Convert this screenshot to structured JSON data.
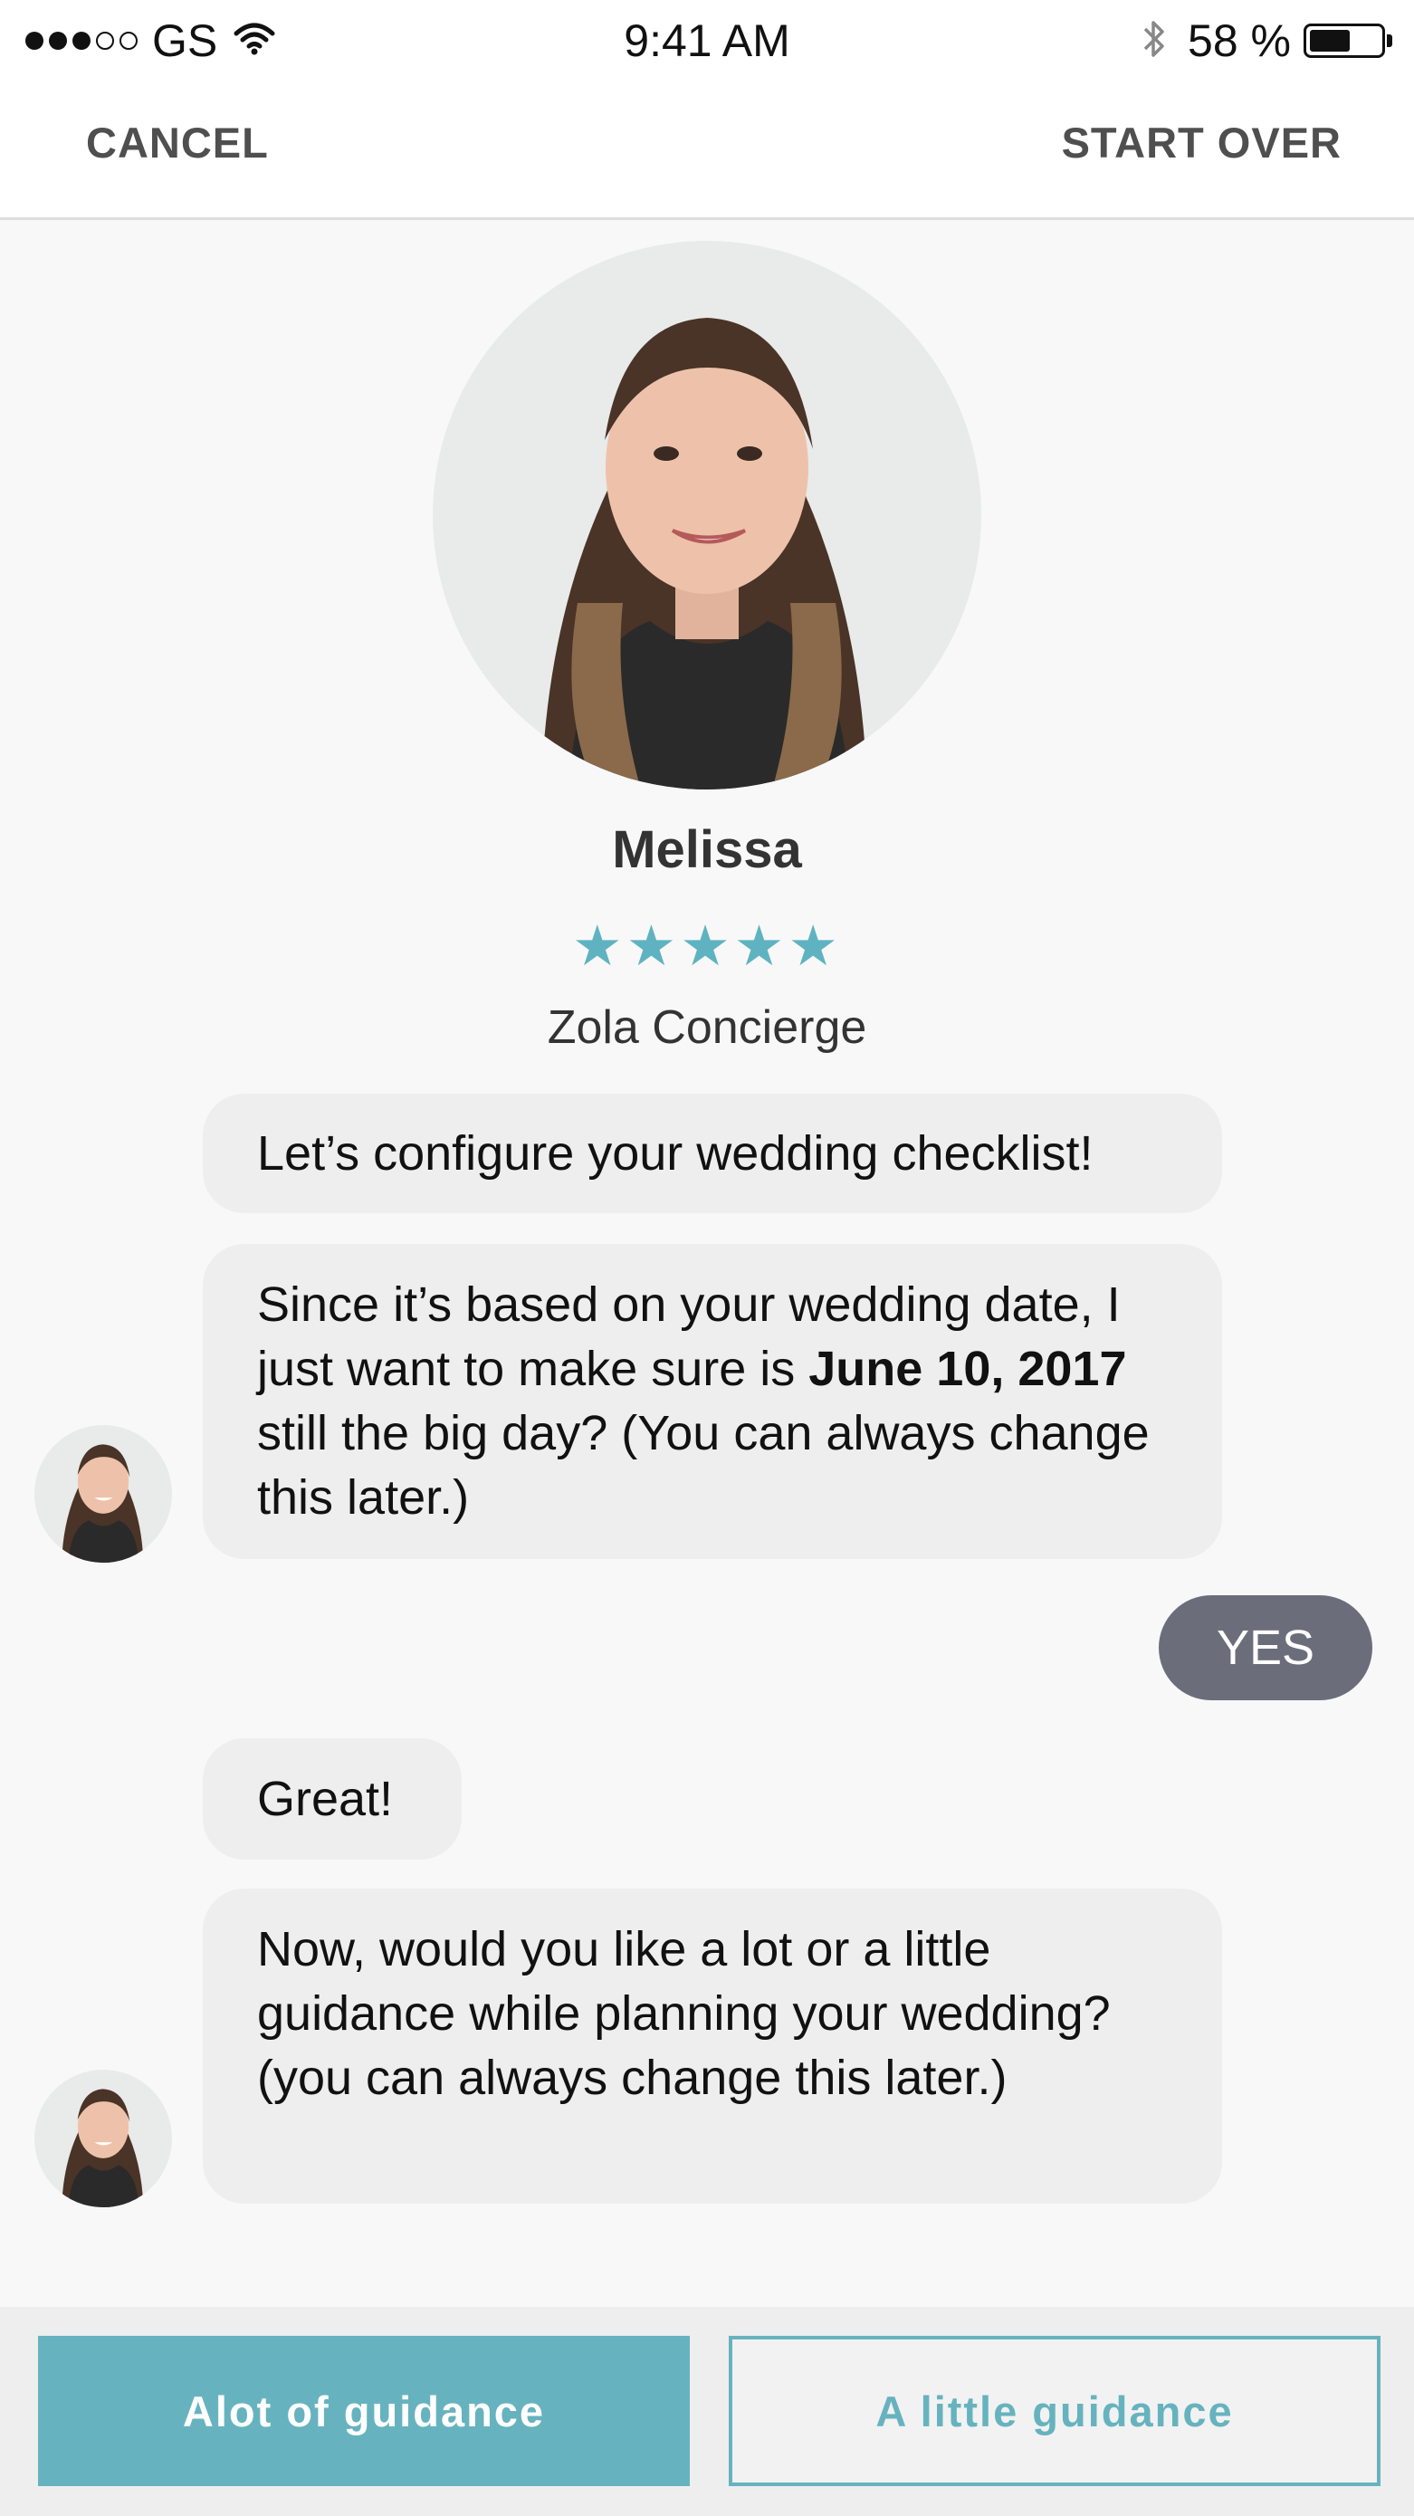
{
  "status_bar": {
    "carrier": "GS",
    "signal_bars_filled": 3,
    "signal_bars_total": 5,
    "time": "9:41 AM",
    "battery_percent": "58 %",
    "battery_level": 0.58,
    "icons": [
      "wifi-icon",
      "bluetooth-icon",
      "battery-icon"
    ]
  },
  "nav": {
    "cancel_label": "CANCEL",
    "start_over_label": "START OVER"
  },
  "agent": {
    "name": "Melissa",
    "stars": "★★★★★",
    "rating": 5,
    "role": "Zola Concierge"
  },
  "chat": {
    "message_1": "Let’s configure your wedding checklist!",
    "message_2_part1": "Since it’s based on your wedding date, I just want to make sure is ",
    "message_2_bold": "June 10, 2017",
    "message_2_part2": " still the big day? (You can always change this later.)",
    "user_reply": "YES",
    "message_3": "Great!",
    "message_4": "Now, would you like a lot or a little guidance while planning your wedding? (you can always change this later.)"
  },
  "actions": {
    "lot_label": "Alot of guidance",
    "little_label": "A little guidance"
  },
  "colors": {
    "accent": "#66b3bf",
    "star": "#5fb3c1",
    "bubble": "#efeeee",
    "reply_bubble": "#6b6e7a",
    "background": "#f8f8f8"
  }
}
